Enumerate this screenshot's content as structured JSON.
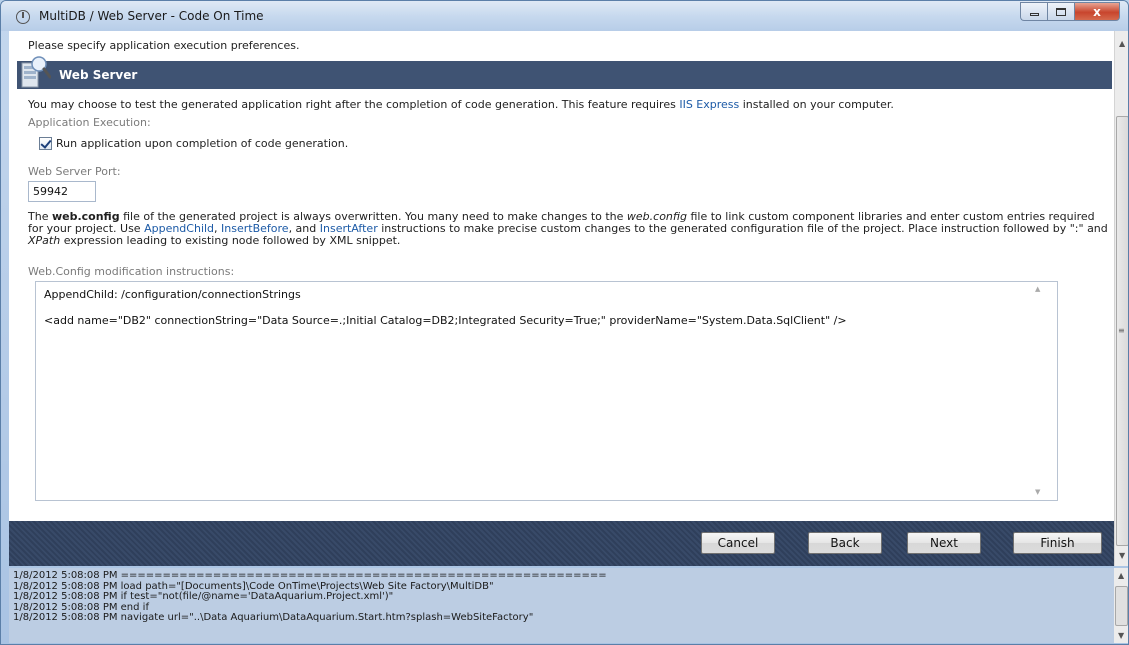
{
  "window": {
    "title": "MultiDB / Web Server - Code On Time",
    "close_glyph": "x"
  },
  "page": {
    "instructions": "Please specify application execution preferences.",
    "section_title": "Web Server",
    "intro_before": "You may choose to test the generated application right after the completion of code generation. This feature requires ",
    "intro_link": "IIS Express",
    "intro_after": " installed on your computer.",
    "application_execution_label": "Application Execution:",
    "run_checkbox_label": "Run application upon completion of code generation.",
    "run_checked": true,
    "port_label": "Web Server Port:",
    "port_value": "59942",
    "para": {
      "t1": "The ",
      "b1": "web.config",
      "t2": " file of the generated project is always overwritten. You many need to make changes to the ",
      "i1": "web.config",
      "t3": " file to link custom component libraries and enter custom entries required for your project. Use ",
      "l1": "AppendChild",
      "t4": ", ",
      "l2": "InsertBefore",
      "t5": ", and ",
      "l3": "InsertAfter",
      "t6": " instructions to make precise custom changes to the generated configuration file of the project. Place instruction followed by \":\" and ",
      "i2": "XPath",
      "t7": " expression leading to existing node followed by XML snippet."
    },
    "webconfig_label": "Web.Config modification instructions:",
    "webconfig_value": "AppendChild: /configuration/connectionStrings\n\n<add name=\"DB2\" connectionString=\"Data Source=.;Initial Catalog=DB2;Integrated Security=True;\" providerName=\"System.Data.SqlClient\" />"
  },
  "buttons": {
    "cancel": "Cancel",
    "back": "Back",
    "next": "Next",
    "finish": "Finish"
  },
  "log": [
    "1/8/2012 5:08:08 PM ==========================================================",
    "1/8/2012 5:08:08 PM load path=\"[Documents]\\Code OnTime\\Projects\\Web Site Factory\\MultiDB\"",
    "1/8/2012 5:08:08 PM if test=\"not(file/@name='DataAquarium.Project.xml')\"",
    "1/8/2012 5:08:08 PM end if",
    "1/8/2012 5:08:08 PM navigate url=\"..\\Data Aquarium\\DataAquarium.Start.htm?splash=WebSiteFactory\""
  ],
  "colors": {
    "header_bg": "#3f5373",
    "link": "#1c5aa6",
    "log_bg": "#bccde3"
  }
}
